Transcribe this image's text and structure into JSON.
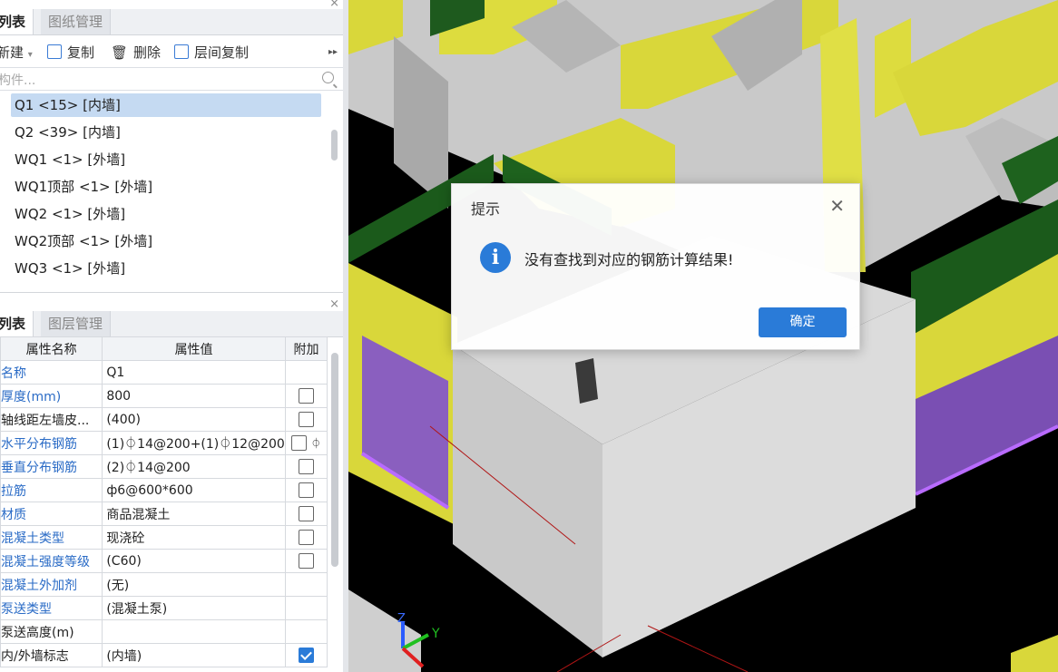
{
  "top_panel": {
    "tabs": [
      "列表",
      "图纸管理"
    ],
    "toolbar": {
      "new": "新建",
      "copy": "复制",
      "delete": "删除",
      "floor_copy": "层间复制"
    },
    "search_placeholder": "构件...",
    "items": [
      "Q1 <15> [内墙]",
      "Q2 <39> [内墙]",
      "WQ1 <1> [外墙]",
      "WQ1顶部 <1> [外墙]",
      "WQ2 <1> [外墙]",
      "WQ2顶部 <1> [外墙]",
      "WQ3 <1> [外墙]"
    ],
    "selected_index": 0
  },
  "prop_panel": {
    "tabs": [
      "列表",
      "图层管理"
    ],
    "headers": [
      "属性名称",
      "属性值",
      "附加"
    ],
    "rows": [
      {
        "name": "名称",
        "value": "Q1",
        "check": null
      },
      {
        "name": "厚度(mm)",
        "value": "800",
        "check": false
      },
      {
        "name": "轴线距左墙皮...",
        "value": "(400)",
        "check": false
      },
      {
        "name": "水平分布钢筋",
        "value": "(1)⏀14@200+(1)⏀12@200",
        "check": false
      },
      {
        "name": "垂直分布钢筋",
        "value": "(2)⏀14@200",
        "check": false
      },
      {
        "name": "拉筋",
        "value": "ф6@600*600",
        "check": false
      },
      {
        "name": "材质",
        "value": "商品混凝土",
        "check": false
      },
      {
        "name": "混凝土类型",
        "value": "现浇砼",
        "check": false
      },
      {
        "name": "混凝土强度等级",
        "value": "(C60)",
        "check": false
      },
      {
        "name": "混凝土外加剂",
        "value": "(无)",
        "check": null
      },
      {
        "name": "泵送类型",
        "value": "(混凝土泵)",
        "check": null
      },
      {
        "name": "泵送高度(m)",
        "value": "",
        "check": null
      },
      {
        "name": "内/外墙标志",
        "value": "(内墙)",
        "check": true
      }
    ],
    "overflow_text": "⏀"
  },
  "dialog": {
    "title": "提示",
    "message": "没有查找到对应的钢筋计算结果!",
    "ok_label": "确定"
  },
  "axes": {
    "z": "Z",
    "y": "Y"
  }
}
